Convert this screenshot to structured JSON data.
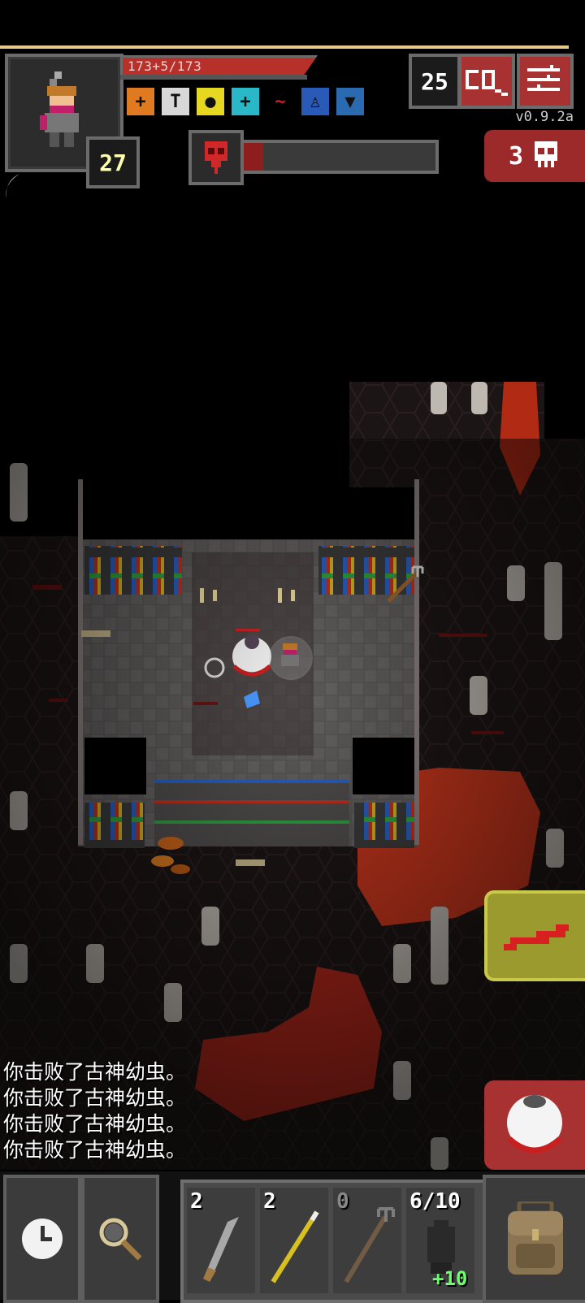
{
  "hud": {
    "hp_text": "173+5/173",
    "hp_fraction": 1.0,
    "hero_level": "27",
    "depth": "25",
    "version": "v0.9.2a",
    "boss_health_fraction": 0.1,
    "kill_count": "3"
  },
  "buffs": [
    {
      "name": "healing-buff-icon",
      "color": "#e07a20",
      "glyph": "+"
    },
    {
      "name": "hammer-buff-icon",
      "color": "#d8d8d8",
      "glyph": "T"
    },
    {
      "name": "light-buff-icon",
      "color": "#e6d820",
      "glyph": "●"
    },
    {
      "name": "bless-buff-icon",
      "color": "#2ab8c8",
      "glyph": "+"
    },
    {
      "name": "bleeding-buff-icon",
      "color": "#d02020",
      "glyph": "~"
    },
    {
      "name": "figure-buff-icon",
      "color": "#2a5ab8",
      "glyph": "♙"
    },
    {
      "name": "shield-buff-icon",
      "color": "#2a6ab0",
      "glyph": "▼"
    }
  ],
  "log": [
    "你击败了古神幼虫。",
    "你击败了古神幼虫。",
    "你击败了古神幼虫。",
    "你击败了古神幼虫。"
  ],
  "quickslots": [
    {
      "name": "quickslot-dart",
      "count": "2",
      "dim": false
    },
    {
      "name": "quickslot-javelin",
      "count": "2",
      "dim": false
    },
    {
      "name": "quickslot-trident",
      "count": "0",
      "dim": true
    },
    {
      "name": "quickslot-wand",
      "charges": "6/10",
      "bonus": "+10"
    }
  ],
  "colors": {
    "accent_red": "#a83232",
    "panel_grey": "#6b6b6b",
    "lava": "#c0341c"
  }
}
